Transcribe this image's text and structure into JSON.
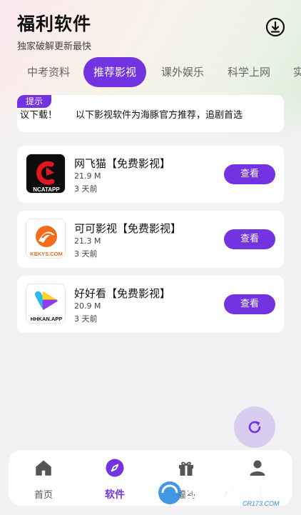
{
  "header": {
    "title": "福利软件",
    "subtitle": "独家破解更新最快"
  },
  "tabs": [
    {
      "label": "中考资料",
      "active": false
    },
    {
      "label": "推荐影视",
      "active": true
    },
    {
      "label": "课外娱乐",
      "active": false
    },
    {
      "label": "科学上网",
      "active": false
    },
    {
      "label": "实",
      "active": false
    }
  ],
  "notice": {
    "tag": "提示",
    "text": "以下影视软件为海豚官方推荐，追剧首选建议下载！"
  },
  "apps": [
    {
      "name": "网飞猫【免费影视】",
      "size": "21.9 M",
      "date": "3 天前",
      "button": "查看",
      "icon_text": "NCATAPP"
    },
    {
      "name": "可可影视【免费影视】",
      "size": "21.3 M",
      "date": "3 天前",
      "button": "查看",
      "icon_text": "KEKYS.COM"
    },
    {
      "name": "好好看【免费影视】",
      "size": "20.9 M",
      "date": "3 天前",
      "button": "查看",
      "icon_text": "HHKAN.APP"
    }
  ],
  "nav": [
    {
      "label": "首页",
      "icon": "home-icon",
      "active": false
    },
    {
      "label": "软件",
      "icon": "compass-icon",
      "active": true
    },
    {
      "label": "福利",
      "icon": "gift-icon",
      "active": false
    },
    {
      "label": "",
      "icon": "user-icon",
      "active": false
    }
  ],
  "watermark": {
    "brand": "西西软件园",
    "domain": "CR173.COM"
  },
  "colors": {
    "accent": "#7433e0",
    "accent_light": "#d9cdef",
    "background": "#f2f2f4"
  }
}
